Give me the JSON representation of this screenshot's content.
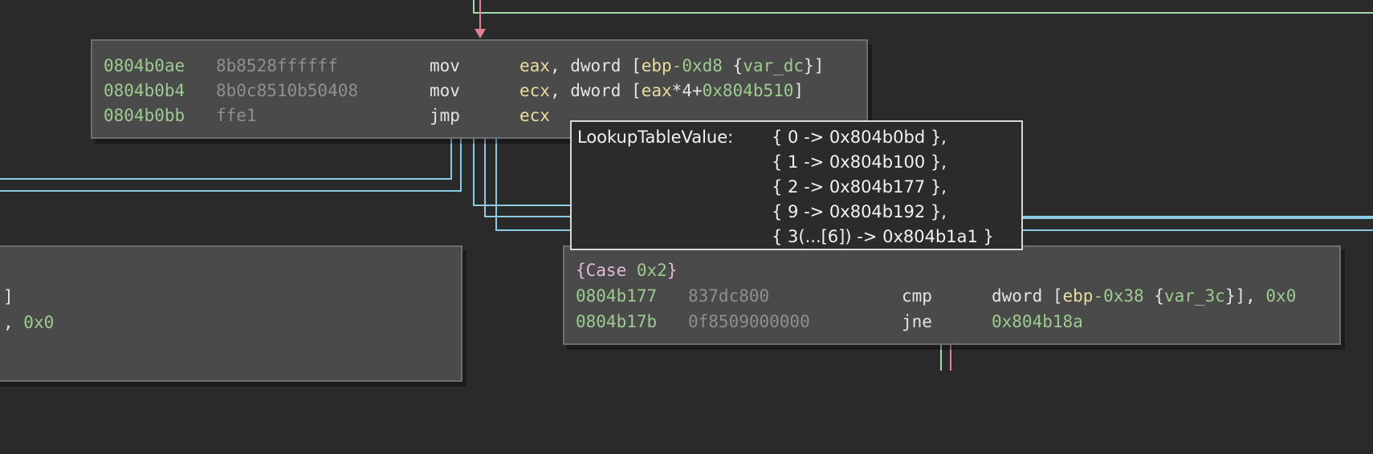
{
  "colors": {
    "background": "#2a2a2a",
    "block_fill": "#4a4a4a",
    "block_border": "#6e6e6e",
    "address": "#9ccc8f",
    "bytes": "#8f8f8f",
    "register": "#e9dd9f",
    "edge_blue": "#8ccbe6",
    "edge_green": "#a8d8b0",
    "edge_red": "#e0848f"
  },
  "block_top": {
    "rows": [
      {
        "addr": "0804b0ae",
        "bytes": "8b8528ffffff",
        "mnem": "mov",
        "reg": "eax",
        "t1": ", dword [",
        "t2": "ebp",
        "num": "-0xd8",
        "t3": " {",
        "var": "var_dc",
        "t4": "}]"
      },
      {
        "addr": "0804b0b4",
        "bytes": "8b0c8510b50408",
        "mnem": "mov",
        "reg": "ecx",
        "t1": ", dword [",
        "t2": "eax",
        "t3": "*4+",
        "num": "0x804b510",
        "t4": "]"
      },
      {
        "addr": "0804b0bb",
        "bytes": "ffe1",
        "mnem": "jmp",
        "reg": "ecx"
      }
    ]
  },
  "block_left": {
    "row1": "]",
    "row2_text": ", ",
    "row2_num": "0x0"
  },
  "block_case": {
    "label_open": "{Case ",
    "label_num": "0x2",
    "label_close": "}",
    "rows": [
      {
        "addr": "0804b177",
        "bytes": "837dc800",
        "mnem": "cmp",
        "t1": "dword [",
        "t2": "ebp",
        "num": "-0x38",
        "t3": " {",
        "var": "var_3c",
        "t4": "}], ",
        "num2": "0x0"
      },
      {
        "addr": "0804b17b",
        "bytes": "0f8509000000",
        "mnem": "jne",
        "target": "0x804b18a"
      }
    ]
  },
  "tooltip": {
    "title": "LookupTableValue: ",
    "entries": [
      "{ 0 -> 0x804b0bd },",
      "{ 1 -> 0x804b100 },",
      "{ 2 -> 0x804b177 },",
      "{ 9 -> 0x804b192 },",
      "{ 3(...[6]) -> 0x804b1a1 }"
    ]
  }
}
